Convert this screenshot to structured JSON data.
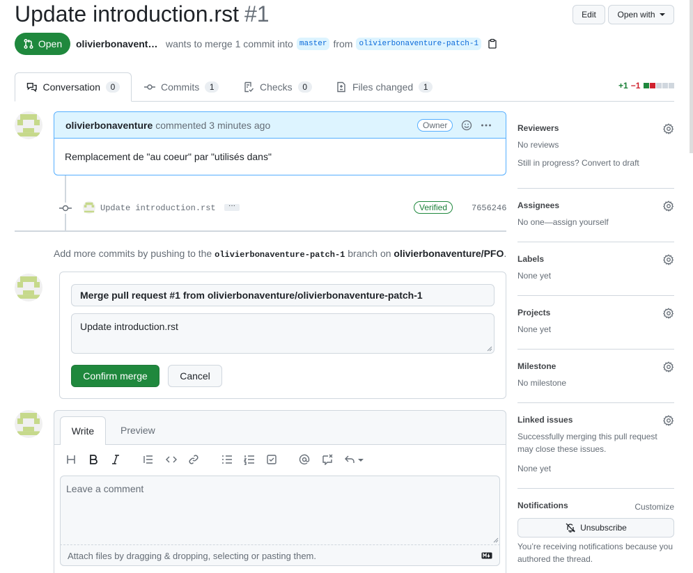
{
  "header": {
    "title": "Update introduction.rst",
    "number": "#1",
    "edit_label": "Edit",
    "open_with_label": "Open with",
    "state": "Open",
    "author": "olivierbonavent…",
    "merge_text": "wants to merge 1 commit into",
    "base_branch": "master",
    "from_text": "from",
    "head_branch": "olivierbonaventure-patch-1"
  },
  "tabs": [
    {
      "label": "Conversation",
      "count": "0"
    },
    {
      "label": "Commits",
      "count": "1"
    },
    {
      "label": "Checks",
      "count": "0"
    },
    {
      "label": "Files changed",
      "count": "1"
    }
  ],
  "diffstat": {
    "additions": "+1",
    "deletions": "−1"
  },
  "comment": {
    "author": "olivierbonaventure",
    "action": "commented 3 minutes ago",
    "badge": "Owner",
    "body": "Remplacement de \"au coeur\" par \"utilisés dans\""
  },
  "commit": {
    "message": "Update introduction.rst",
    "more": "···",
    "verified": "Verified",
    "sha": "7656246"
  },
  "add_more": {
    "prefix": "Add more commits by pushing to the",
    "branch": "olivierbonaventure-patch-1",
    "middle": "branch on",
    "repo": "olivierbonaventure/PFO",
    "suffix": "."
  },
  "merge": {
    "title": "Merge pull request #1 from olivierbonaventure/olivierbonaventure-patch-1",
    "message": "Update introduction.rst",
    "confirm_label": "Confirm merge",
    "cancel_label": "Cancel"
  },
  "editor": {
    "write_tab": "Write",
    "preview_tab": "Preview",
    "placeholder": "Leave a comment",
    "attach_text": "Attach files by dragging & dropping, selecting or pasting them."
  },
  "sidebar": {
    "reviewers": {
      "title": "Reviewers",
      "value": "No reviews",
      "extra": "Still in progress? Convert to draft"
    },
    "assignees": {
      "title": "Assignees",
      "value": "No one—assign yourself"
    },
    "labels": {
      "title": "Labels",
      "value": "None yet"
    },
    "projects": {
      "title": "Projects",
      "value": "None yet"
    },
    "milestone": {
      "title": "Milestone",
      "value": "No milestone"
    },
    "linked": {
      "title": "Linked issues",
      "desc": "Successfully merging this pull request may close these issues.",
      "value": "None yet"
    },
    "notifications": {
      "title": "Notifications",
      "customize": "Customize",
      "unsubscribe": "Unsubscribe",
      "reason": "You’re receiving notifications because you authored the thread."
    }
  },
  "colors": {
    "accent_green": "#1f883d",
    "link_blue": "#0969da",
    "avatar_green": "#c6d98b"
  }
}
